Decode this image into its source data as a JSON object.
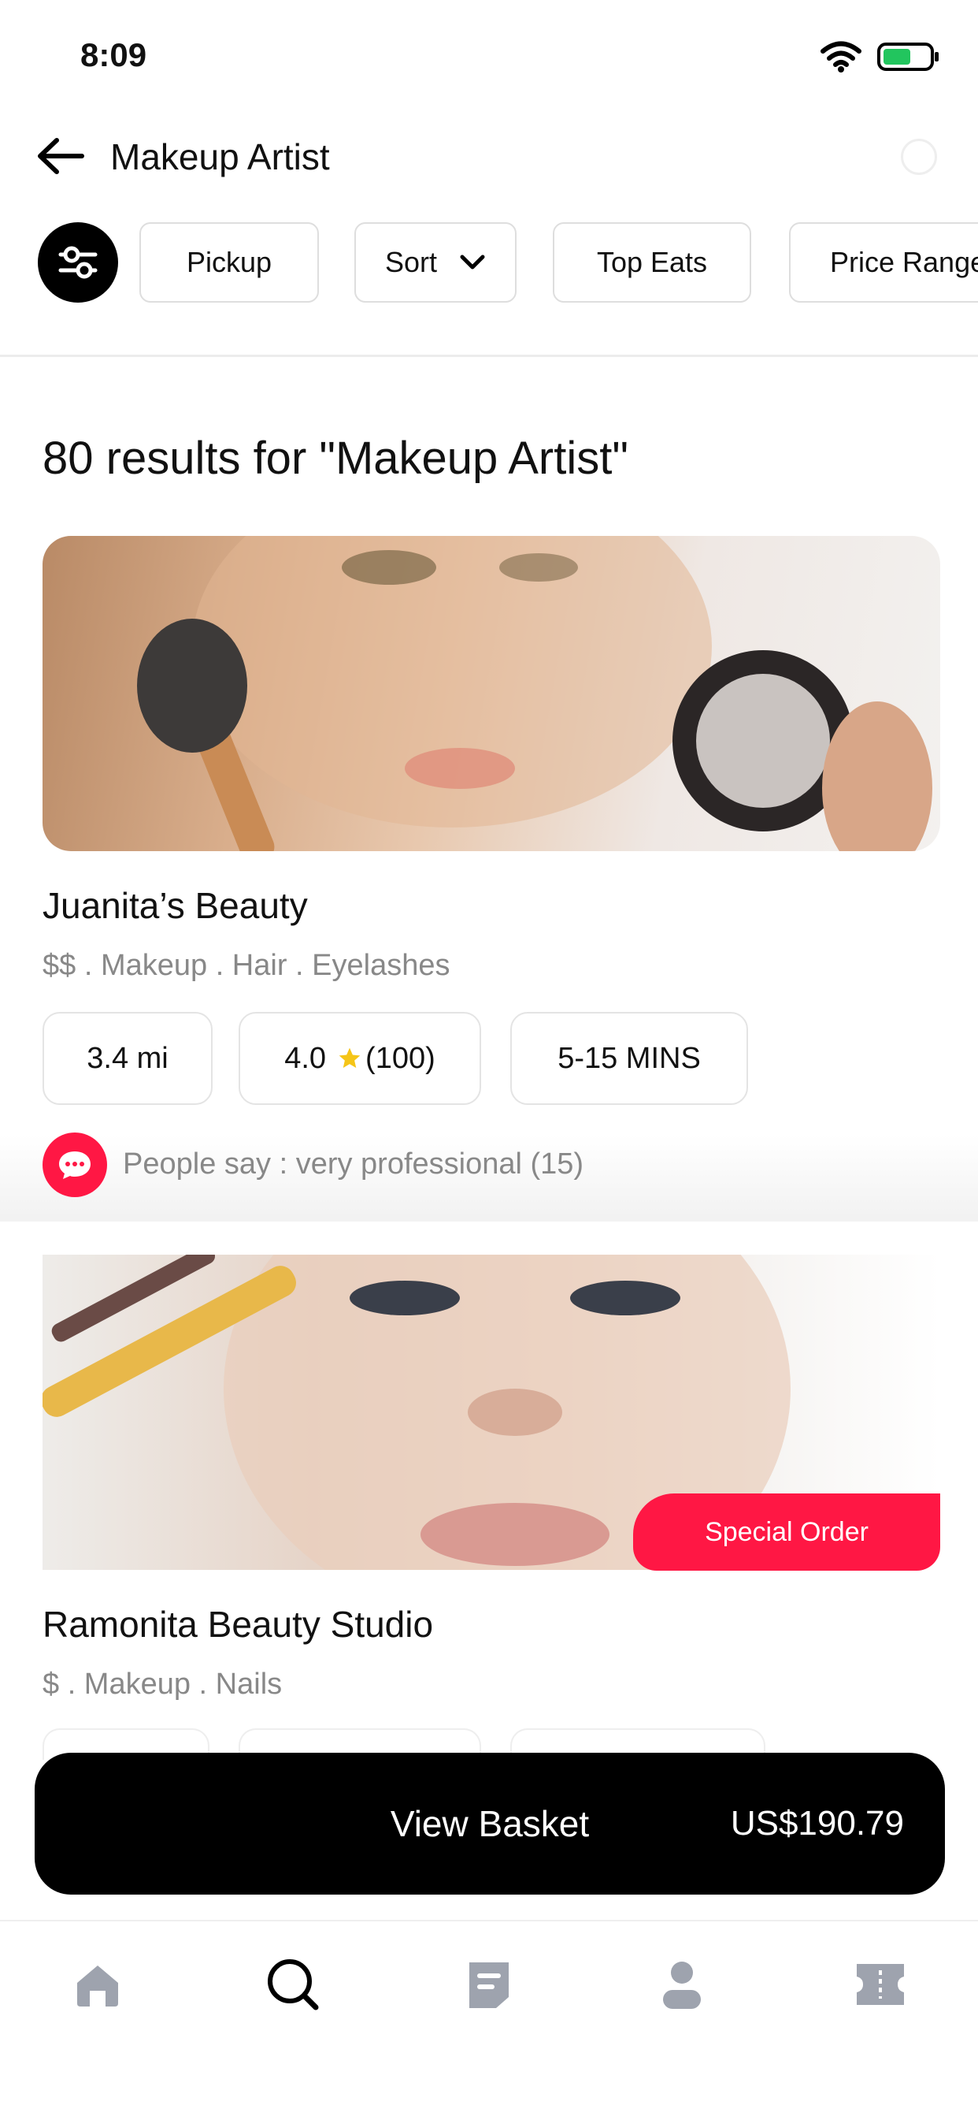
{
  "status_bar": {
    "time": "8:09",
    "battery_color": "#22c55e"
  },
  "header": {
    "title": "Makeup Artist"
  },
  "filters": {
    "pickup": "Pickup",
    "sort": "Sort",
    "top_eats": "Top Eats",
    "price_range": "Price Range"
  },
  "results": {
    "title": "80 results for \"Makeup Artist\""
  },
  "stores": [
    {
      "name": "Juanita’s Beauty",
      "tags": "$$ . Makeup . Hair . Eyelashes",
      "distance": "3.4 mi",
      "rating": "4.0",
      "reviews": "(100)",
      "time": "5-15 MINS",
      "review_snippet": "People say : very professional (15)"
    },
    {
      "name": "Ramonita Beauty Studio",
      "tags": "$ . Makeup . Nails",
      "badge": "Special Order"
    }
  ],
  "basket": {
    "label": "View Basket",
    "total": "US$190.79"
  },
  "tabs": [
    "home-icon",
    "search-icon",
    "orders-icon",
    "profile-icon",
    "coupon-icon"
  ],
  "colors": {
    "accent": "#ff1744",
    "star": "#f5c518",
    "primary": "#000000"
  }
}
